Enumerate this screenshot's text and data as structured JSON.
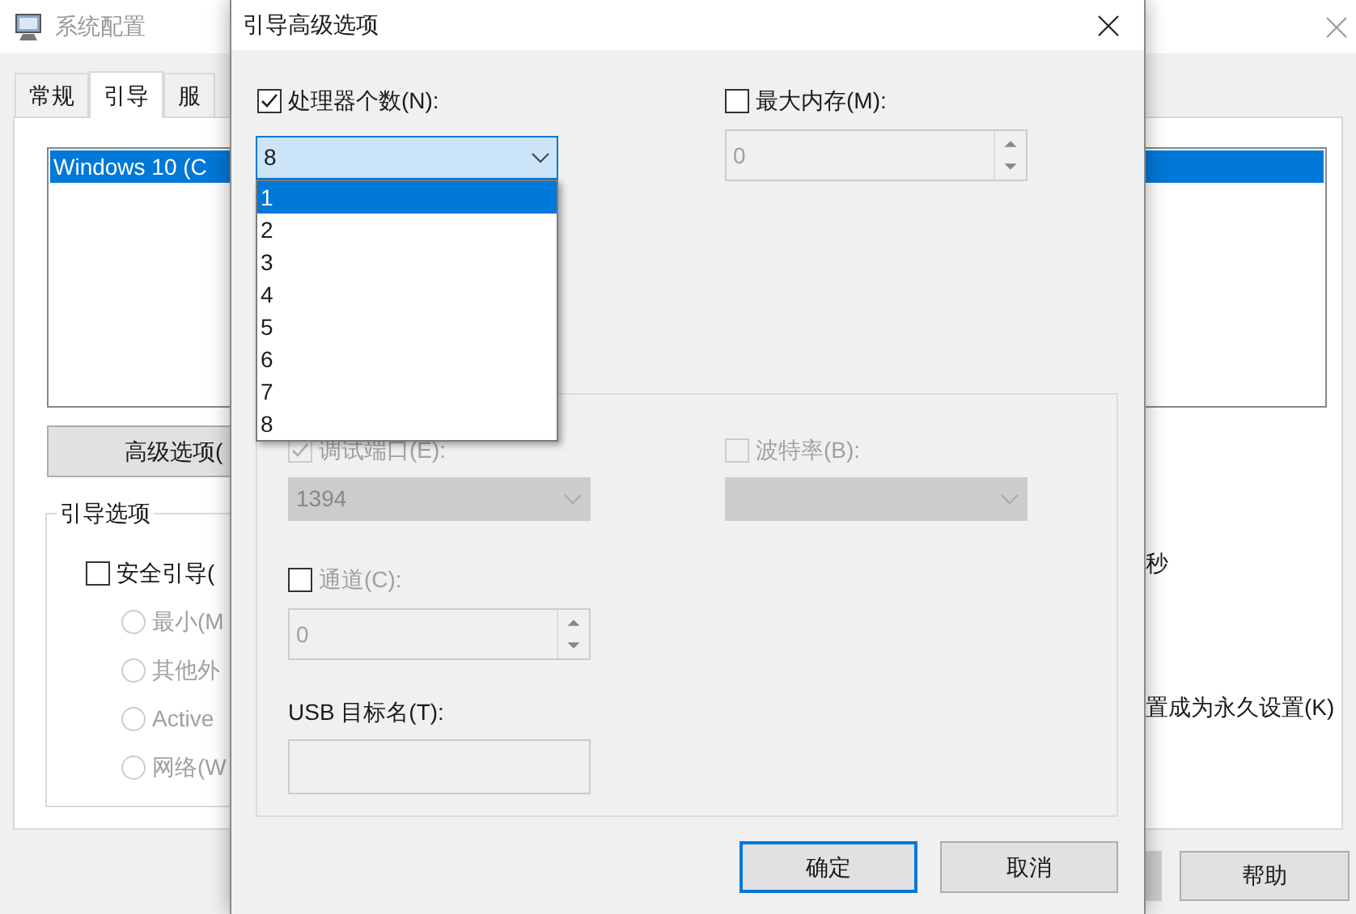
{
  "main_window": {
    "title": "系统配置",
    "tabs": [
      {
        "label": "常规",
        "selected": false
      },
      {
        "label": "引导",
        "selected": true
      },
      {
        "label": "服",
        "selected": false
      }
    ],
    "os_list": [
      {
        "label": "Windows 10 (C",
        "selected": true
      }
    ],
    "advanced_button": "高级选项(",
    "boot_options": {
      "title": "引导选项",
      "safe_boot": {
        "label": "安全引导(",
        "checked": false
      },
      "modes": [
        {
          "label": "最小(M",
          "selected": false,
          "disabled": true
        },
        {
          "label": "其他外",
          "selected": false,
          "disabled": true
        },
        {
          "label": "Active",
          "selected": false,
          "disabled": true
        },
        {
          "label": "网络(W",
          "selected": false,
          "disabled": true
        }
      ]
    },
    "timeout_unit": "秒",
    "permanent_label": "置成为永久设置(K)",
    "help_button": "帮助"
  },
  "dialog": {
    "title": "引导高级选项",
    "processors": {
      "label": "处理器个数(N):",
      "checked": true,
      "value": "8",
      "expanded": true,
      "options": [
        {
          "label": "1",
          "highlighted": true
        },
        {
          "label": "2",
          "highlighted": false
        },
        {
          "label": "3",
          "highlighted": false
        },
        {
          "label": "4",
          "highlighted": false
        },
        {
          "label": "5",
          "highlighted": false
        },
        {
          "label": "6",
          "highlighted": false
        },
        {
          "label": "7",
          "highlighted": false
        },
        {
          "label": "8",
          "highlighted": false
        }
      ]
    },
    "max_memory": {
      "label": "最大内存(M):",
      "checked": false,
      "value": "0"
    },
    "debug": {
      "port": {
        "label": "调试端口(E):",
        "checked": true,
        "disabled": true,
        "value": "1394"
      },
      "baud": {
        "label": "波特率(B):",
        "checked": false,
        "disabled": true
      },
      "channel": {
        "label": "通道(C):",
        "checked": false,
        "value": "0"
      },
      "usb_label": "USB 目标名(T):"
    },
    "buttons": [
      {
        "label": "确定",
        "default": true
      },
      {
        "label": "取消",
        "default": false
      }
    ]
  }
}
